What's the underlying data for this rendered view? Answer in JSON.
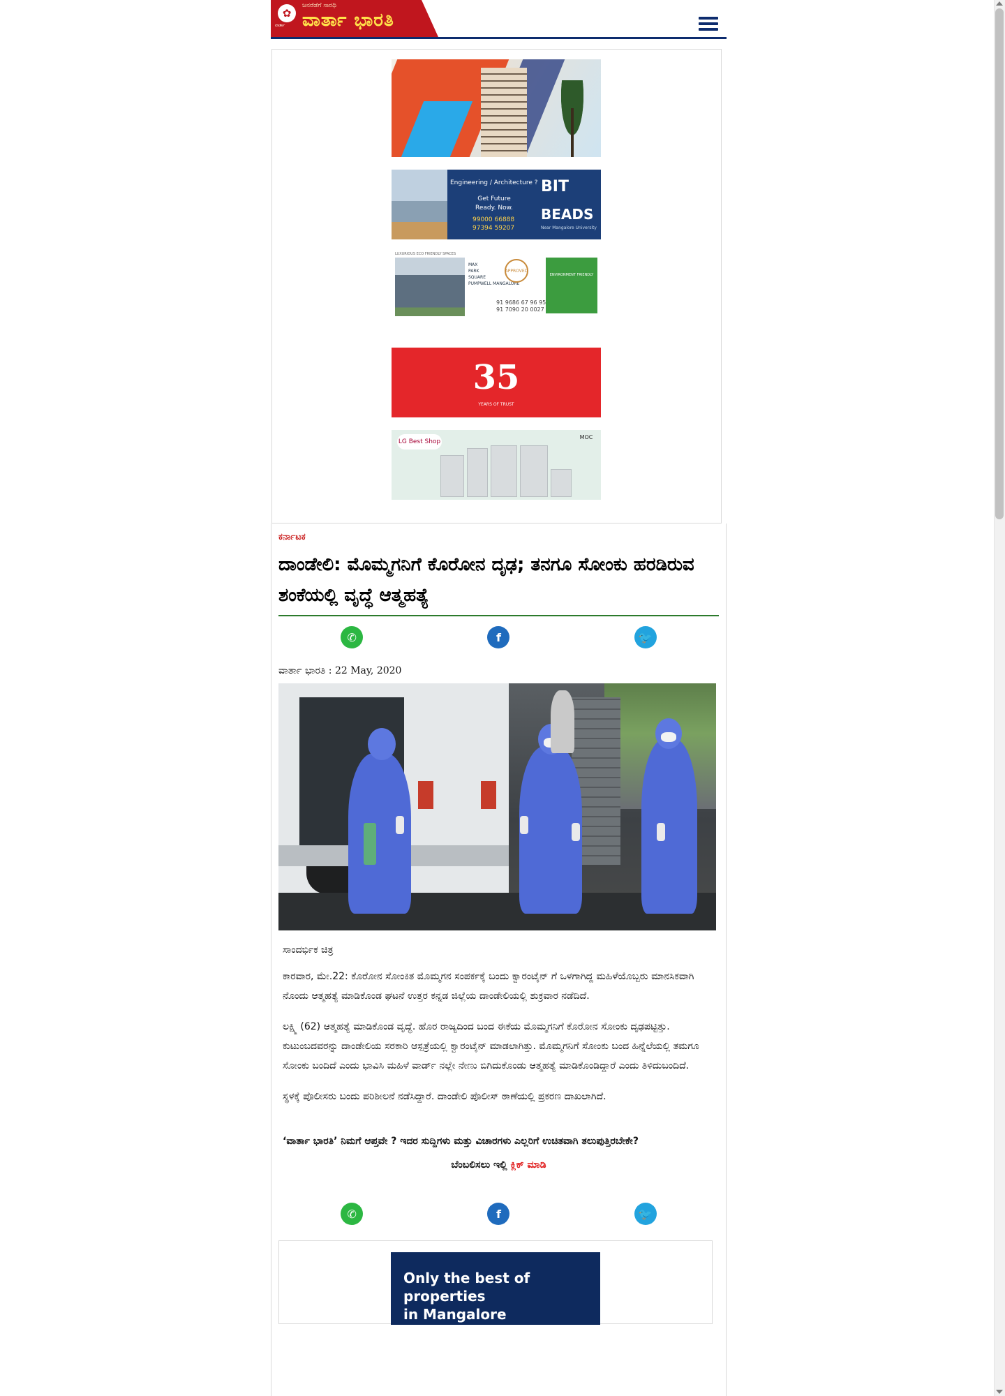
{
  "header": {
    "logo_tagline": "ಜನರೆಡೆಗೆ ಸಾರಥಿ",
    "logo_emblem_caption": "ವಾರ್ತಾ",
    "logo_name": "ವಾರ್ತಾ ಭಾರತಿ",
    "menu_icon": "hamburger-menu-icon"
  },
  "ads": {
    "ad2": {
      "question": "Engineering / Architecture ?",
      "line1": "Get Future",
      "line2": "Ready. Now.",
      "phone1": "99000 66888",
      "phone2": "97394 59207",
      "brand1": "BIT",
      "brand2": "BEADS",
      "brand2_sub": "Near Mangalore University"
    },
    "ad3": {
      "tag": "LUXURIOUS ECO FRIENDLY SPACES",
      "project_line1": "MAX",
      "project_line2": "PARK",
      "project_line3": "SQUARE",
      "location": "PUMPWELL MANGALORE",
      "phone1": "91 9686 67 96 95",
      "phone2": "91 7090 20 0027",
      "badge": "APPROVED",
      "eco": "ENVIRONMENT FRIENDLY"
    },
    "ad4": {
      "number": "35",
      "subtitle": "YEARS OF TRUST"
    },
    "ad5": {
      "brand": "LG Best Shop",
      "partner": "MOC"
    },
    "bottom": {
      "headline_line1": "Only the best of properties",
      "headline_line2": "in Mangalore"
    }
  },
  "article": {
    "category": "ಕರ್ನಾಟಕ",
    "title": "ದಾಂಡೇಲಿ: ಮೊಮ್ಮಗನಿಗೆ ಕೊರೋನ ದೃಢ; ತನಗೂ ಸೋಂಕು ಹರಡಿರುವ ಶಂಕೆಯಲ್ಲಿ ವೃದ್ಧೆ ಆತ್ಮಹತ್ಯೆ",
    "byline": "ವಾರ್ತಾ ಭಾರತಿ : 22 May, 2020",
    "caption": "ಸಾಂದರ್ಭಿಕ ಚಿತ್ರ",
    "paragraphs": [
      "ಕಾರವಾರ, ಮೇ.22: ಕೊರೋನ ಸೋಂಕಿತ ಮೊಮ್ಮಗನ ಸಂಪರ್ಕಕ್ಕೆ ಬಂದು ಕ್ವಾರಂಟೈನ್ ಗೆ ಒಳಗಾಗಿದ್ದ ಮಹಿಳೆಯೊಬ್ಬರು ಮಾನಸಿಕವಾಗಿ ನೊಂದು ಆತ್ಮಹತ್ಯೆ ಮಾಡಿಕೊಂಡ ಘಟನೆ ಉತ್ತರ ಕನ್ನಡ ಜಿಲ್ಲೆಯ ದಾಂಡೇಲಿಯಲ್ಲಿ ಶುಕ್ರವಾರ ನಡೆದಿದೆ.",
      "ಲಕ್ಷ್ಮಿ (62) ಆತ್ಮಹತ್ಯೆ ಮಾಡಿಕೊಂಡ ವೃದ್ಧೆ. ಹೊರ ರಾಜ್ಯದಿಂದ ಬಂದ ಈಕೆಯ ಮೊಮ್ಮಗನಿಗೆ ಕೊರೋನ ಸೋಂಕು ದೃಢಪಟ್ಟಿತ್ತು. ಕುಟುಂಬದವರನ್ನು ದಾಂಡೇಲಿಯ ಸರಕಾರಿ ಆಸ್ಪತ್ರೆಯಲ್ಲಿ ಕ್ವಾರಂಟೈನ್ ಮಾಡಲಾಗಿತ್ತು. ಮೊಮ್ಮಗನಿಗೆ ಸೋಂಕು ಬಂದ ಹಿನ್ನೆಲೆಯಲ್ಲಿ ತಮಗೂ ಸೋಂಕು ಬಂದಿದೆ ಎಂದು ಭಾವಿಸಿ ಮಹಿಳೆ ವಾರ್ಡ್ ನಲ್ಲೇ ನೇಣು ಬಿಗಿದುಕೊಂಡು ಆತ್ಮಹತ್ಯೆ ಮಾಡಿಕೊಂಡಿದ್ದಾರೆ ಎಂದು ತಿಳಿದುಬಂದಿದೆ.",
      "ಸ್ಥಳಕ್ಕೆ ಪೊಲೀಸರು ಬಂದು ಪರಿಶೀಲನೆ ನಡೆಸಿದ್ದಾರೆ. ದಾಂಡೇಲಿ ಪೊಲೀಸ್ ಠಾಣೆಯಲ್ಲಿ ಪ್ರಕರಣ ದಾಖಲಾಗಿದೆ."
    ],
    "promo": "‘ವಾರ್ತಾ ಭಾರತಿ’ ನಿಮಗೆ ಆಪ್ತವೇ ? ಇದರ ಸುದ್ದಿಗಳು ಮತ್ತು ವಿಚಾರಗಳು ಎಲ್ಲರಿಗೆ ಉಚಿತವಾಗಿ ತಲುಪುತ್ತಿರಬೇಕೇ?",
    "subscribe_prefix": "ಬೆಂಬಲಿಸಲು ಇಲ್ಲಿ",
    "subscribe_link": "ಕ್ಲಿಕ್ ಮಾಡಿ"
  },
  "share": {
    "whatsapp_icon": "whatsapp-icon",
    "facebook_icon": "facebook-icon",
    "twitter_icon": "twitter-icon",
    "whatsapp_glyph": "✆",
    "facebook_glyph": "f",
    "twitter_glyph": "🐦"
  },
  "colors": {
    "brand_red": "#c0161e",
    "brand_yellow": "#ffe14a",
    "nav_blue": "#0d2c6e",
    "title_rule_green": "#2c7a2c",
    "category_red": "#c91a1a"
  }
}
